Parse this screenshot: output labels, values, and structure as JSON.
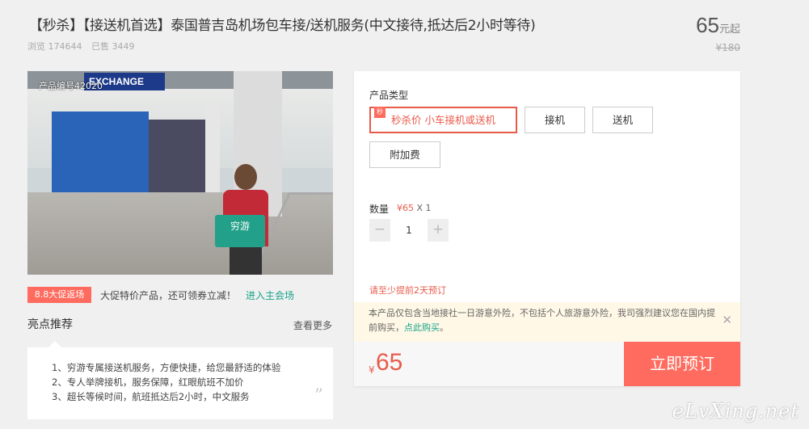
{
  "header": {
    "title": "【秒杀】【接送机首选】泰国普吉岛机场包车接/送机服务(中文接待,抵达后2小时等待)",
    "views_label": "浏览 174644",
    "sold_label": "已售 3449",
    "price": "65",
    "price_unit": "元起",
    "old_price": "¥180"
  },
  "photo": {
    "product_code": "产品编号42020",
    "sign_text": "EXCHANGE",
    "board_text": "穷游"
  },
  "promo": {
    "badge": "8.8大促返场",
    "text": "大促特价产品，还可领券立减！",
    "link": "进入主会场"
  },
  "highlights": {
    "title": "亮点推荐",
    "more": "查看更多",
    "items": [
      "1、穷游专属接送机服务，方便快捷，给您最舒适的体验",
      "2、专人举牌接机，服务保障，红眼航班不加价",
      "3、超长等候时间，航班抵达后2小时，中文服务"
    ]
  },
  "booking": {
    "type_label": "产品类型",
    "options": [
      {
        "label": "秒杀价 小车接机或送机",
        "flag": "秒",
        "selected": true
      },
      {
        "label": "接机",
        "selected": false
      },
      {
        "label": "送机",
        "selected": false
      },
      {
        "label": "附加费",
        "selected": false
      }
    ],
    "qty_label": "数量",
    "unit_price": "¥65",
    "qty_times": "X 1",
    "qty_minus": "−",
    "qty_plus": "+",
    "qty_value": "1",
    "advance_notice": "请至少提前2天预订",
    "insurance_notice": "本产品仅包含当地接社一日游意外险，不包括个人旅游意外险，我司强烈建议您在国内提前购买，",
    "insurance_link": "点此购买",
    "insurance_end": "。",
    "close": "✕",
    "currency": "¥",
    "total": "65",
    "book_button": "立即预订"
  },
  "watermark": "eLvXing.net",
  "colors": {
    "accent": "#ff6b5e",
    "link": "#18a38b",
    "notice_bg": "#fff8e6"
  }
}
